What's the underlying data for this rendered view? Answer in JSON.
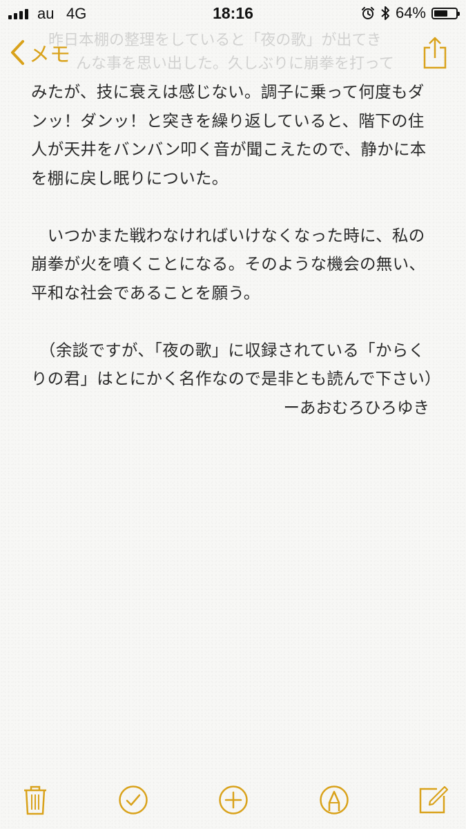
{
  "status_bar": {
    "carrier": "au",
    "network": "4G",
    "time": "18:16",
    "battery_percent": "64%",
    "battery_level": 0.64
  },
  "nav": {
    "back_label": "メモ",
    "ghost_line_1": "昨日本棚の整理をしていると「夜の歌」が出てき",
    "ghost_line_2": "んな事を思い出した。久しぶりに崩拳を打って"
  },
  "note": {
    "paragraphs": [
      "みたが、技に衰えは感じない。調子に乗って何度もダンッ！ダンッ！と突きを繰り返していると、階下の住人が天井をバンバン叩く音が聞こえたので、静かに本を棚に戻し眠りについた。",
      "　いつかまた戦わなければいけなくなった時に、私の崩拳が火を噴くことになる。そのような機会の無い、平和な社会であることを願う。",
      "　（余談ですが、「夜の歌」に収録されている「からくりの君」はとにかく名作なので是非とも読んで下さい）"
    ],
    "signature": "ーあおむろひろゆき"
  },
  "colors": {
    "accent": "#d9a21b",
    "text": "#2a2a2a",
    "background": "#f7f7f5"
  },
  "toolbar": {
    "items": [
      "trash-icon",
      "checklist-icon",
      "add-icon",
      "markup-icon",
      "compose-icon"
    ]
  }
}
